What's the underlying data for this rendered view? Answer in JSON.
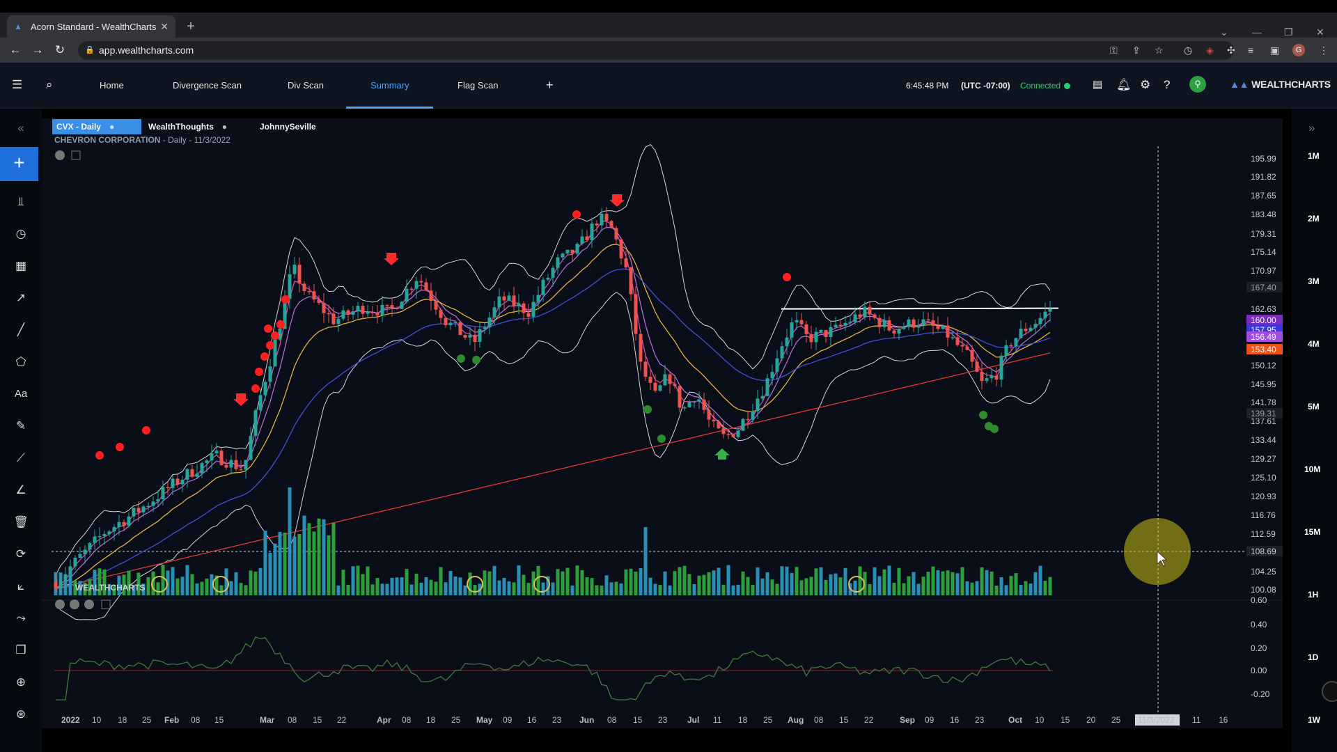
{
  "browser": {
    "tab_title": "Acorn Standard - WealthCharts",
    "url": "app.wealthcharts.com"
  },
  "header": {
    "nav": [
      "Home",
      "Divergence Scan",
      "Div Scan",
      "Summary",
      "Flag Scan"
    ],
    "active_nav": "Summary",
    "time": "6:45:48 PM",
    "timezone": "(UTC -07:00)",
    "connection_status": "Connected",
    "logo_text": "WEALTHCHARTS"
  },
  "chart_tabs": {
    "ticker_tab": "CVX - Daily",
    "tab2": "WealthThoughts",
    "tab3": "JohnnySeville"
  },
  "chart_header": {
    "company": "CHEVRON CORPORATION",
    "details": "- Daily - 11/3/2022"
  },
  "watermark": "WEALTHCHARTS",
  "timeframes": [
    "1M",
    "2M",
    "3M",
    "4M",
    "5M",
    "10M",
    "15M",
    "1H",
    "1D",
    "1W"
  ],
  "price_axis": [
    "195.99",
    "191.82",
    "187.65",
    "183.48",
    "179.31",
    "175.14",
    "170.97",
    "162.63",
    "150.12",
    "145.95",
    "141.78",
    "137.61",
    "133.44",
    "129.27",
    "125.10",
    "120.93",
    "116.76",
    "112.59",
    "104.25",
    "100.08"
  ],
  "price_boxes": [
    {
      "label": "167.40",
      "bg": "#1a1f2a",
      "fg": "#9aa0aa"
    },
    {
      "label": "160.00",
      "bg": "#7b2cbf",
      "fg": "#ffffff"
    },
    {
      "label": "157.95",
      "bg": "#3a36d9",
      "fg": "#ffffff"
    },
    {
      "label": "156.49",
      "bg": "#9d4edd",
      "fg": "#ffffff"
    },
    {
      "label": "153.40",
      "bg": "#e8541a",
      "fg": "#ffffff"
    },
    {
      "label": "139.31",
      "bg": "#1a1f2a",
      "fg": "#9aa0aa"
    },
    {
      "label": "108.69",
      "bg": "#1a1f2a",
      "fg": "#c9ccd1"
    }
  ],
  "osc_axis": [
    "0.60",
    "0.40",
    "0.20",
    "0.00",
    "-0.20"
  ],
  "date_axis": [
    "2022",
    "10",
    "18",
    "25",
    "Feb",
    "08",
    "15",
    "Mar",
    "08",
    "15",
    "22",
    "Apr",
    "08",
    "18",
    "25",
    "May",
    "09",
    "16",
    "23",
    "Jun",
    "08",
    "15",
    "23",
    "Jul",
    "11",
    "18",
    "25",
    "Aug",
    "08",
    "15",
    "22",
    "Sep",
    "09",
    "16",
    "23",
    "Oct",
    "10",
    "15",
    "20",
    "25",
    "11/3/2022",
    "11",
    "16"
  ],
  "chart_data": {
    "type": "candlestick",
    "symbol": "CVX",
    "interval": "Daily",
    "resistance_line": 162.63,
    "crosshair_price": 108.69,
    "crosshair_date": "11/3/2022",
    "ylim": [
      100.08,
      195.99
    ],
    "osc_ylim": [
      -0.2,
      0.6
    ],
    "colors": {
      "up": "#26a69a",
      "down": "#ef5350",
      "vol_up": "#2e9e3c",
      "vol_down": "#2a8fb5",
      "sma200": "#e53935",
      "ema_fast": "#c070e0",
      "ema_mid": "#e3b341",
      "ema_slow": "#3f51d6"
    }
  }
}
